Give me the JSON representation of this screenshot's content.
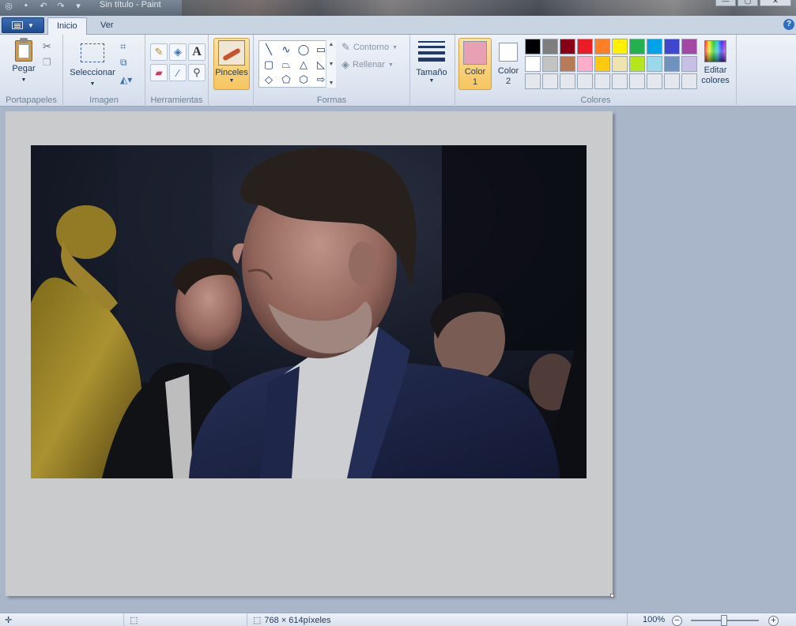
{
  "window": {
    "title": "Sin título - Paint"
  },
  "tabs": [
    {
      "label": "Inicio"
    },
    {
      "label": "Ver"
    }
  ],
  "ribbon": {
    "clipboard": {
      "paste_label": "Pegar",
      "group_label": "Portapapeles"
    },
    "image": {
      "select_label": "Seleccionar",
      "group_label": "Imagen"
    },
    "tools": {
      "group_label": "Herramientas",
      "text_tool_glyph": "A"
    },
    "brushes": {
      "label": "Pinceles"
    },
    "shapes": {
      "outline_label": "Contorno",
      "fill_label": "Rellenar",
      "group_label": "Formas"
    },
    "size": {
      "label": "Tamaño"
    },
    "colors": {
      "color1_label_line1": "Color",
      "color1_label_line2": "1",
      "color1_value": "#e8a0b4",
      "color2_label_line1": "Color",
      "color2_label_line2": "2",
      "color2_value": "#ffffff",
      "edit_label_line1": "Editar",
      "edit_label_line2": "colores",
      "group_label": "Colores",
      "palette": [
        "#000000",
        "#7f7f7f",
        "#880015",
        "#ed1c24",
        "#ff7f27",
        "#fff200",
        "#22b14c",
        "#00a2e8",
        "#3f48cc",
        "#a349a4",
        "#ffffff",
        "#c3c3c3",
        "#b97a57",
        "#ffaec9",
        "#ffc90e",
        "#efe4b0",
        "#b5e61d",
        "#99d9ea",
        "#7092be",
        "#c8bfe7",
        "#e4e8ee",
        "#e4e8ee",
        "#e4e8ee",
        "#e4e8ee",
        "#e4e8ee",
        "#e4e8ee",
        "#e4e8ee",
        "#e4e8ee",
        "#e4e8ee",
        "#e4e8ee"
      ]
    }
  },
  "status": {
    "dimensions": "768 × 614píxeles",
    "zoom": "100%"
  },
  "icons": {
    "file_menu": "file-menu-icon",
    "help": "?",
    "zoom_out": "−",
    "zoom_in": "+"
  }
}
